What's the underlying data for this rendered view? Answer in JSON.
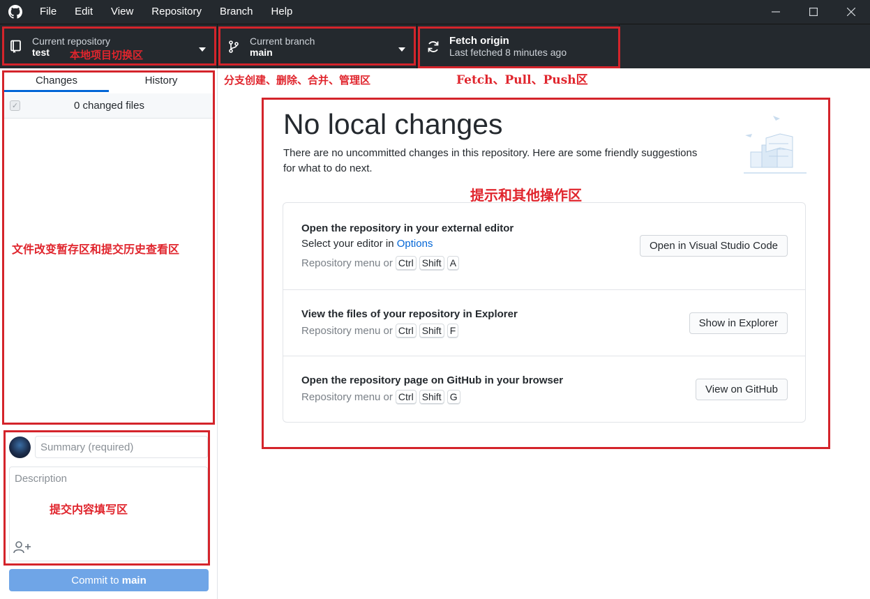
{
  "menu": {
    "items": [
      "File",
      "Edit",
      "View",
      "Repository",
      "Branch",
      "Help"
    ]
  },
  "toolbar": {
    "repo_label": "Current repository",
    "repo_value": "test",
    "branch_label": "Current branch",
    "branch_value": "main",
    "fetch_title": "Fetch origin",
    "fetch_sub": "Last fetched 8 minutes ago"
  },
  "sidebar": {
    "tabs": [
      "Changes",
      "History"
    ],
    "changed_files": "0 changed files",
    "summary_placeholder": "Summary (required)",
    "description_placeholder": "Description",
    "commit_prefix": "Commit to ",
    "commit_branch": "main"
  },
  "main": {
    "title": "No local changes",
    "description": "There are no uncommitted changes in this repository. Here are some friendly suggestions for what to do next.",
    "cards": [
      {
        "title": "Open the repository in your external editor",
        "line_prefix": "Select your editor in ",
        "line_link": "Options",
        "hint_prefix": "Repository menu or",
        "keys": [
          "Ctrl",
          "Shift",
          "A"
        ],
        "button": "Open in Visual Studio Code"
      },
      {
        "title": "View the files of your repository in Explorer",
        "hint_prefix": "Repository menu or",
        "keys": [
          "Ctrl",
          "Shift",
          "F"
        ],
        "button": "Show in Explorer"
      },
      {
        "title": "Open the repository page on GitHub in your browser",
        "hint_prefix": "Repository menu or",
        "keys": [
          "Ctrl",
          "Shift",
          "G"
        ],
        "button": "View on GitHub"
      }
    ]
  },
  "annotations": {
    "repo_switch": "本地项目切换区",
    "branch_area": "分支创建、删除、合并、管理区",
    "fetch_area": "Fetch、Pull、Push区",
    "tips_area": "提示和其他操作区",
    "changes_area": "文件改变暂存区和提交历史查看区",
    "commit_area": "提交内容填写区"
  },
  "colors": {
    "accent": "#0366d6",
    "annotation_red": "#d4242b",
    "toolbar_bg": "#24292e",
    "commit_button": "#6fa5e7"
  }
}
